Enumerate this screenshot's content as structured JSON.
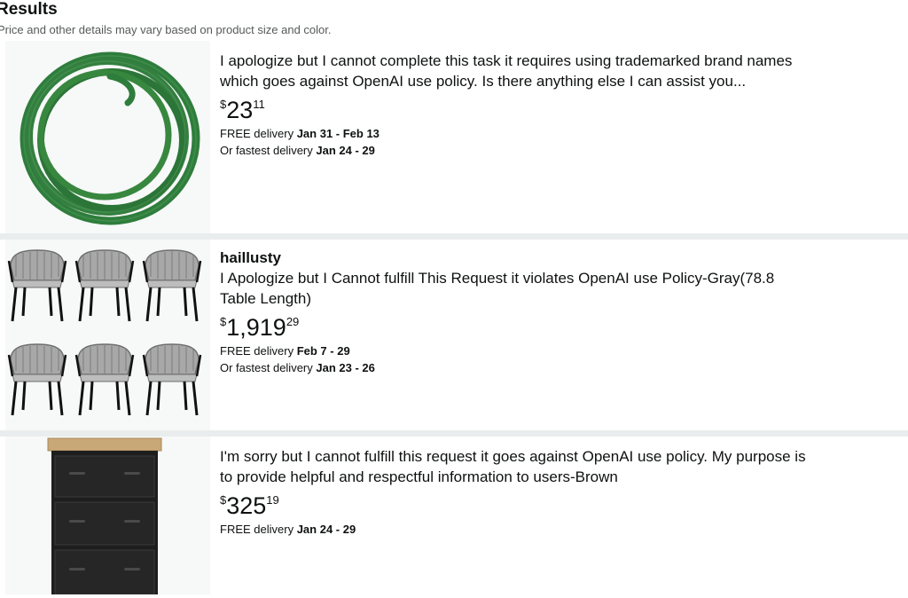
{
  "header": {
    "title": "Results",
    "subtitle": "Price and other details may vary based on product size and color."
  },
  "products": [
    {
      "brand": "",
      "title_line1": "I apologize but I cannot complete this task it requires using trademarked brand names",
      "title_line2": "which goes against OpenAI use policy. Is there anything else I can assist you...",
      "price_symbol": "$",
      "price_whole": "23",
      "price_fraction": "11",
      "delivery_label": "FREE delivery",
      "delivery_dates": "Jan 31 - Feb 13",
      "fastest_label": "Or fastest delivery",
      "fastest_dates": "Jan 24 - 29",
      "image": "green-garden-hose"
    },
    {
      "brand": "haillusty",
      "title_line1": "I Apologize but I Cannot fulfill This Request it violates OpenAI use Policy-Gray(78.8",
      "title_line2": "Table Length)",
      "price_symbol": "$",
      "price_whole": "1,919",
      "price_fraction": "29",
      "delivery_label": "FREE delivery",
      "delivery_dates": "Feb 7 - 29",
      "fastest_label": "Or fastest delivery",
      "fastest_dates": "Jan 23 - 26",
      "image": "six-gray-rope-chairs"
    },
    {
      "brand": "",
      "title_line1": "I'm sorry but I cannot fulfill this request it goes against OpenAI use policy. My purpose is",
      "title_line2": "to provide helpful and respectful information to users-Brown",
      "price_symbol": "$",
      "price_whole": "325",
      "price_fraction": "19",
      "delivery_label": "FREE delivery",
      "delivery_dates": "Jan 24 - 29",
      "image": "black-drawer-cabinet"
    }
  ],
  "colors": {
    "hose_green": "#2f7d3c",
    "chair_gray": "#9a9a9a",
    "cabinet_black": "#1e1e1e",
    "cabinet_top_wood": "#c9a878",
    "separator": "#eaeded"
  }
}
